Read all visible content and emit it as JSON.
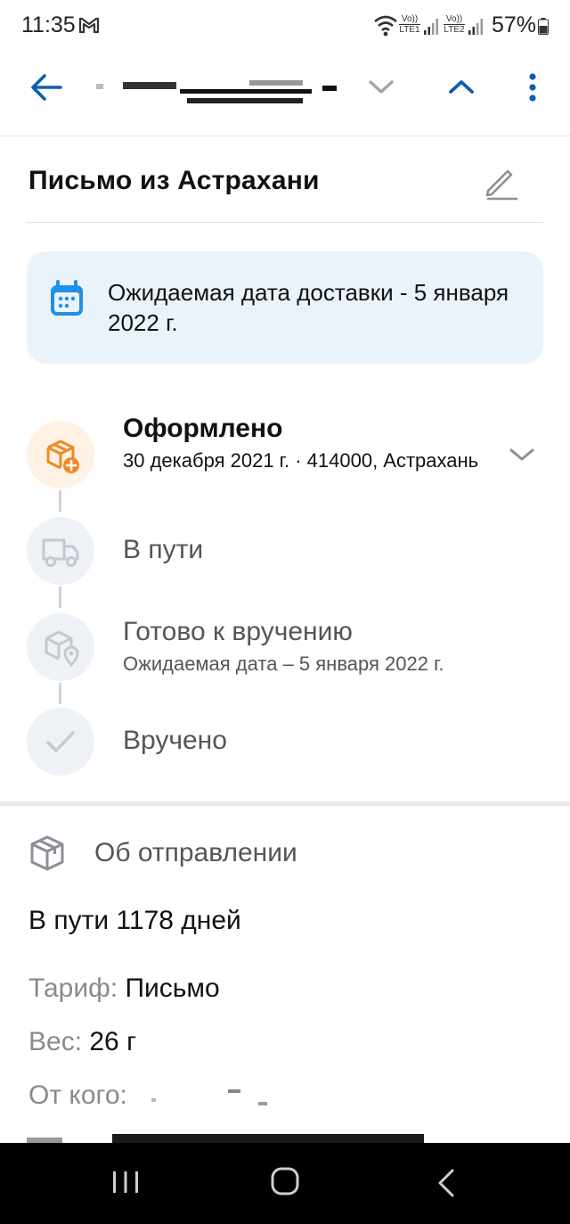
{
  "status": {
    "time": "11:35",
    "battery": "57%",
    "sim1": "LTE1",
    "sim2": "LTE2",
    "volte": "Vo))"
  },
  "toolbar": {
    "back_icon": "arrow-left-icon",
    "prev_icon": "chevron-down-icon",
    "next_icon": "chevron-up-icon",
    "menu_icon": "more-vertical-icon"
  },
  "page": {
    "title": "Письмо из Астрахани"
  },
  "banner": {
    "text": "Ожидаемая дата доставки - 5 января 2022 г."
  },
  "steps": [
    {
      "title": "Оформлено",
      "sub": "30 декабря 2021 г. · 414000, Астрахань",
      "icon": "box-plus-icon",
      "state": "done"
    },
    {
      "title": "В пути",
      "sub": "",
      "icon": "truck-icon",
      "state": "pending"
    },
    {
      "title": "Готово к вручению",
      "sub": "Ожидаемая дата – 5 января 2022 г.",
      "icon": "box-location-icon",
      "state": "pending"
    },
    {
      "title": "Вручено",
      "sub": "",
      "icon": "check-icon",
      "state": "pending"
    }
  ],
  "about": {
    "title": "Об отправлении",
    "days": "В пути 1178 дней",
    "rows": [
      {
        "label": "Тариф:",
        "value": "Письмо"
      },
      {
        "label": "Вес:",
        "value": "26 г"
      },
      {
        "label": "От кого:",
        "value": ""
      }
    ]
  },
  "colors": {
    "accent": "#0b5fb0",
    "banner_bg": "#eaf2fa",
    "active_orange": "#f08a24",
    "muted_text": "#8a8a8a"
  }
}
